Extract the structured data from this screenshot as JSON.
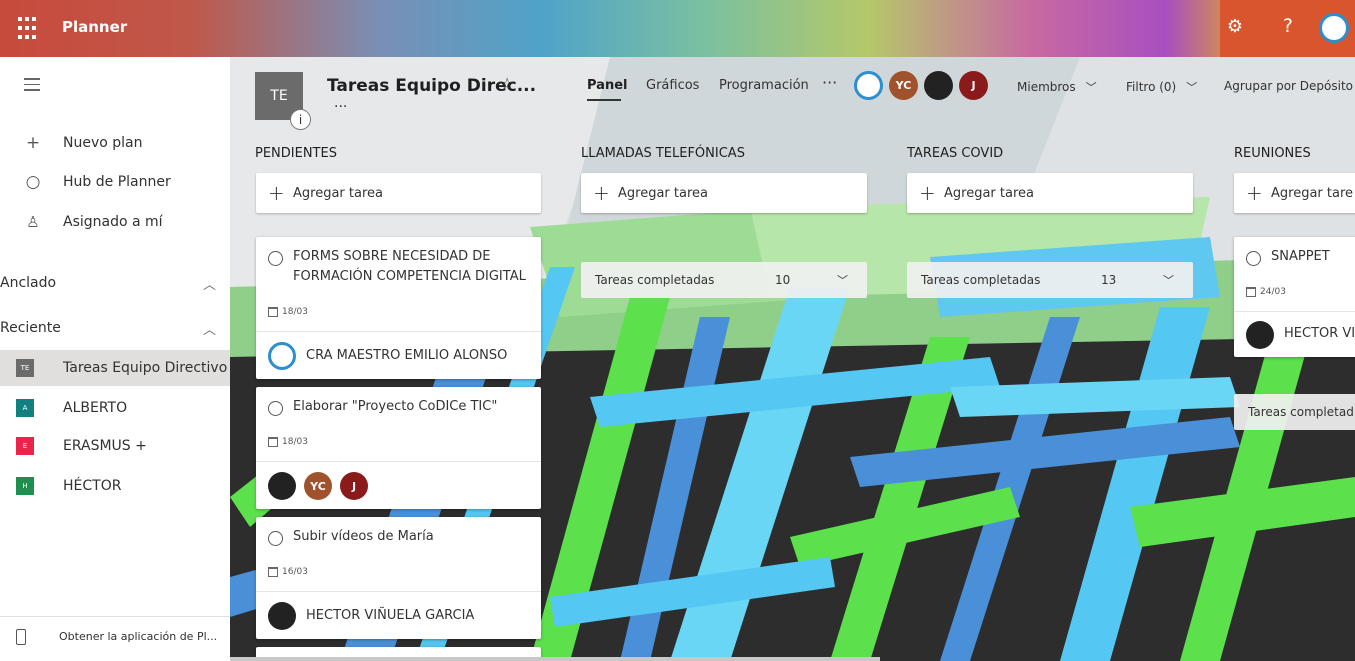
{
  "app": {
    "name": "Planner"
  },
  "sidebar": {
    "nav": [
      {
        "icon": "plus-icon",
        "label": "Nuevo plan"
      },
      {
        "icon": "hub-circle-icon",
        "label": "Hub de Planner"
      },
      {
        "icon": "person-icon",
        "label": "Asignado a mí"
      }
    ],
    "pinned_label": "Anclado",
    "recent_label": "Reciente",
    "plans": [
      {
        "badge": "TE",
        "label": "Tareas Equipo Directivo",
        "color": "#6b6b6b"
      },
      {
        "badge": "A",
        "label": "ALBERTO",
        "color": "#128080"
      },
      {
        "badge": "E",
        "label": "ERASMUS +",
        "color": "#e8254a"
      },
      {
        "badge": "H",
        "label": "HÉCTOR",
        "color": "#1e8f4e"
      }
    ],
    "get_app": "Obtener la aplicación de Pl..."
  },
  "plan": {
    "tile": "TE",
    "info": "i",
    "title": "Tareas Equipo Direc...",
    "dots": "...",
    "tabs": [
      "Panel",
      "Gráficos",
      "Programación"
    ],
    "more": "···",
    "member_initials": [
      "YC",
      "J"
    ],
    "members_label": "Miembros",
    "filter_label": "Filtro (0)",
    "group_label": "Agrupar por Depósito"
  },
  "add_task": "Agregar tarea",
  "add_task_cut": "Agregar tare",
  "buckets": [
    {
      "name": "PENDIENTES"
    },
    {
      "name": "LLAMADAS TELEFÓNICAS",
      "completed_label": "Tareas completadas",
      "completed_count": "10"
    },
    {
      "name": "TAREAS COVID",
      "completed_label": "Tareas completadas",
      "completed_count": "13"
    },
    {
      "name": "REUNIONES",
      "completed_label": "Tareas completad"
    }
  ],
  "tasks": [
    {
      "title_l1": "FORMS SOBRE NECESIDAD DE",
      "title_l2": "FORMACIÓN COMPETENCIA DIGITAL",
      "date": "18/03",
      "assignee": "CRA MAESTRO EMILIO ALONSO"
    },
    {
      "title": "Elaborar \"Proyecto CoDICe TIC\"",
      "date": "18/03",
      "avatars": [
        "YC",
        "J"
      ]
    },
    {
      "title": "Subir vídeos de María",
      "date": "16/03",
      "assignee": "HECTOR VIÑUELA GARCIA"
    },
    {
      "title": "SNAPPET",
      "date": "24/03",
      "assignee": "HECTOR VI"
    }
  ],
  "colors": {
    "yc": "#a0522d",
    "j": "#8b1a1a",
    "accent": "#31752f"
  }
}
